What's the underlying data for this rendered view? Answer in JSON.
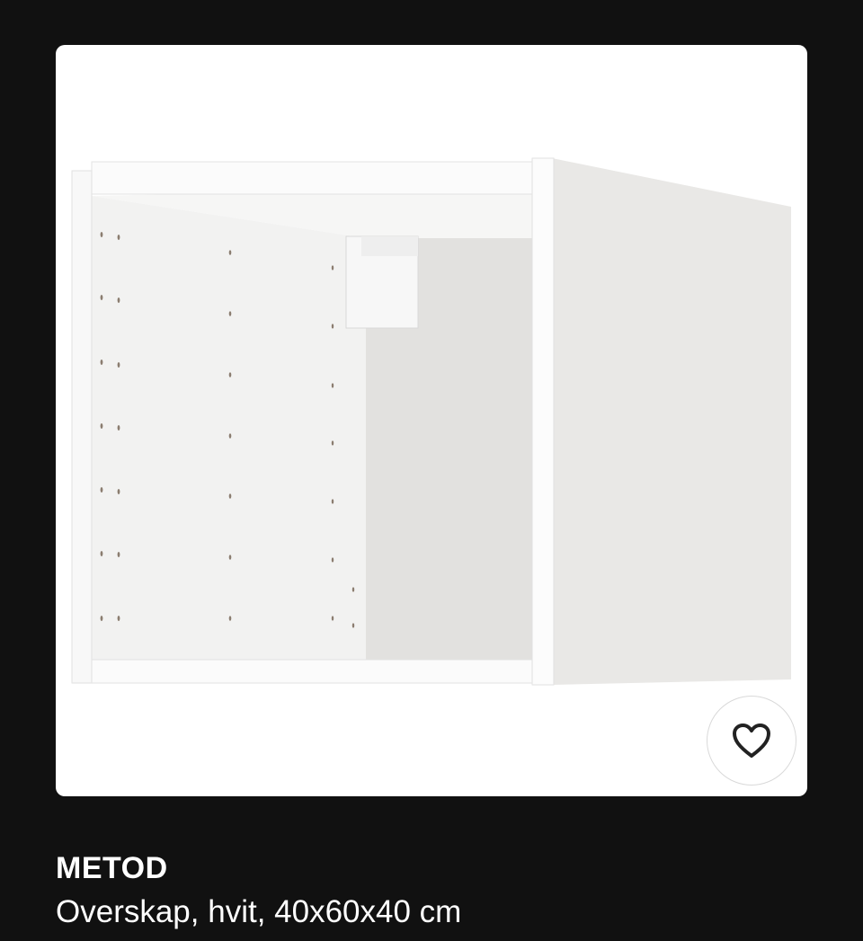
{
  "product": {
    "name": "METOD",
    "description": "Overskap, hvit, 40x60x40 cm",
    "image_icon": "wall-cabinet-frame-illustration",
    "favorite_icon": "heart-outline-icon"
  },
  "colors": {
    "background": "#111111",
    "card": "#ffffff",
    "text": "#ffffff"
  }
}
